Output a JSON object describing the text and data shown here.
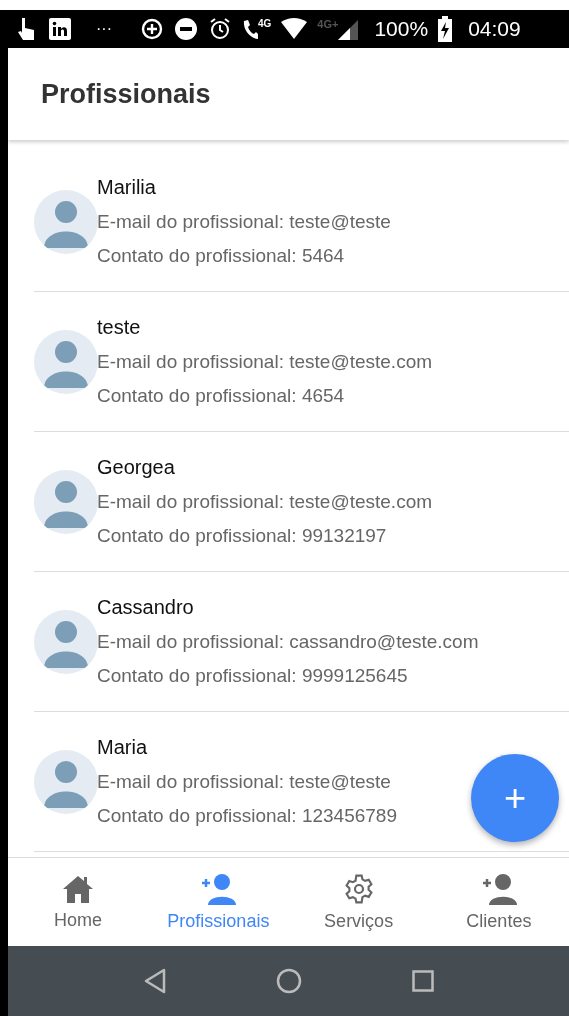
{
  "status_bar": {
    "dots": "···",
    "call_label": "4G",
    "network_label": "4G+",
    "battery": "100%",
    "time": "04:09"
  },
  "app_bar": {
    "title": "Profissionais"
  },
  "professionals": [
    {
      "name": "Marilia",
      "email": "E-mail do profissional: teste@teste",
      "contact": "Contato do profissional: 5464"
    },
    {
      "name": "teste",
      "email": "E-mail do profissional: teste@teste.com",
      "contact": "Contato do profissional: 4654"
    },
    {
      "name": "Georgea",
      "email": "E-mail do profissional: teste@teste.com",
      "contact": "Contato do profissional: 99132197"
    },
    {
      "name": "Cassandro",
      "email": "E-mail do profissional: cassandro@teste.com",
      "contact": "Contato do profissional: 9999125645"
    },
    {
      "name": "Maria",
      "email": "E-mail do profissional: teste@teste",
      "contact": "Contato do profissional: 123456789"
    }
  ],
  "fab": {
    "label": "+"
  },
  "bottom_nav": [
    {
      "kind": "home",
      "label": "Home",
      "selected": false
    },
    {
      "kind": "person-add",
      "label": "Profissionais",
      "selected": true
    },
    {
      "kind": "gear",
      "label": "Serviços",
      "selected": false
    },
    {
      "kind": "person-add",
      "label": "Clientes",
      "selected": false
    }
  ]
}
